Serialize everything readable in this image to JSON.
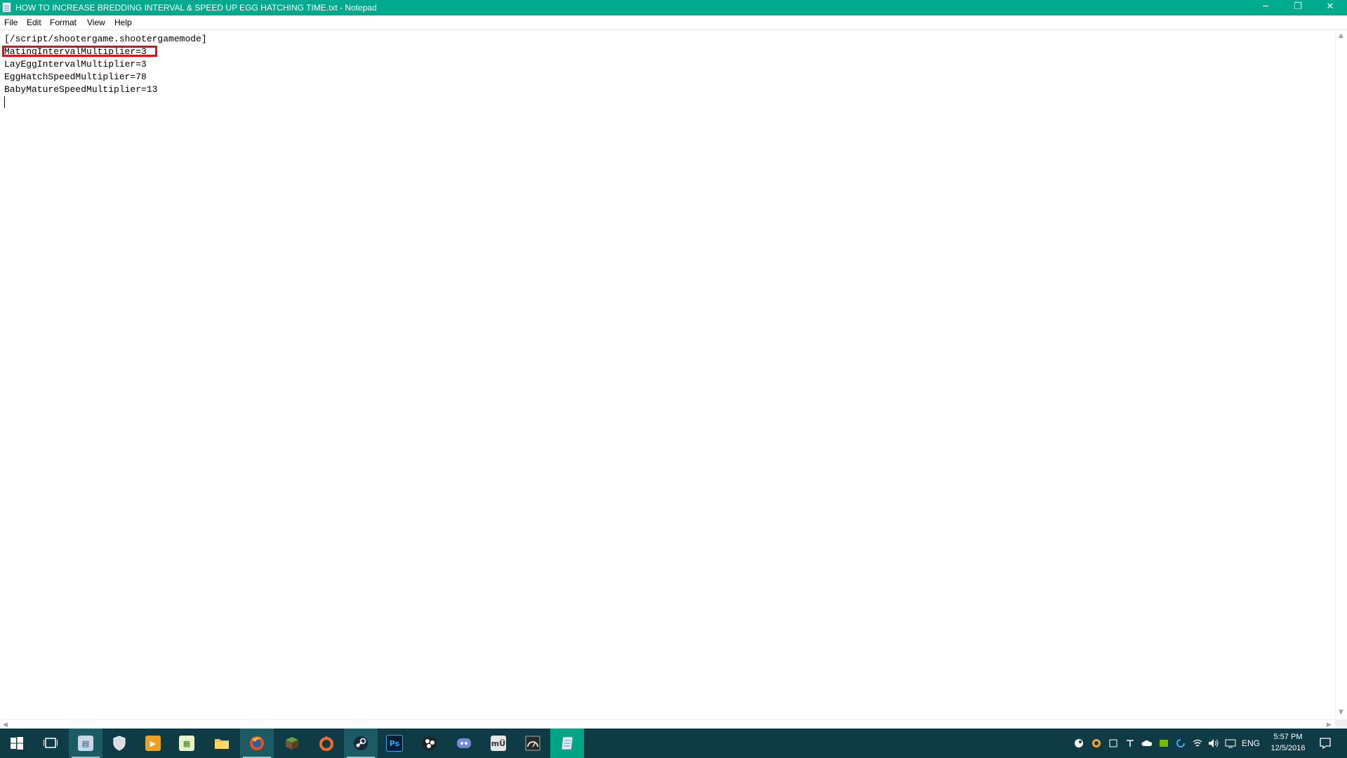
{
  "window": {
    "title": "HOW TO INCREASE BREDDING INTERVAL & SPEED UP EGG HATCHING TIME.txt - Notepad",
    "minimize_glyph": "─",
    "maximize_glyph": "❐",
    "close_glyph": "✕",
    "accent_color": "#00aa8e"
  },
  "menu": {
    "items": [
      "File",
      "Edit",
      "Format",
      "View",
      "Help"
    ]
  },
  "editor": {
    "lines": [
      "[/script/shootergame.shootergamemode]",
      "MatingIntervalMultiplier=3",
      "LayEggIntervalMultiplier=3",
      "EggHatchSpeedMultiplier=78",
      "BabyMatureSpeedMultiplier=13"
    ],
    "highlighted_line": "MatingIntervalMultiplier=3",
    "highlight_color": "#e01010"
  },
  "taskbar": {
    "apps": [
      {
        "name": "start",
        "icon": "windows-logo-icon"
      },
      {
        "name": "task-view",
        "icon": "task-view-icon"
      },
      {
        "name": "app-1",
        "icon": "app-window-icon",
        "active": true
      },
      {
        "name": "app-2",
        "icon": "shield-icon"
      },
      {
        "name": "media",
        "icon": "media-player-icon"
      },
      {
        "name": "spreadsheet",
        "icon": "spreadsheet-icon"
      },
      {
        "name": "file-explorer",
        "icon": "folder-icon"
      },
      {
        "name": "firefox",
        "icon": "firefox-icon",
        "active": true
      },
      {
        "name": "minecraft",
        "icon": "grass-block-icon"
      },
      {
        "name": "origin",
        "icon": "origin-icon"
      },
      {
        "name": "steam",
        "icon": "steam-icon",
        "active": true
      },
      {
        "name": "photoshop",
        "icon": "photoshop-icon",
        "label": "Ps"
      },
      {
        "name": "obs",
        "icon": "obs-icon"
      },
      {
        "name": "discord",
        "icon": "discord-icon"
      },
      {
        "name": "app-mu",
        "icon": "mu-app-icon",
        "label": "mÜ"
      },
      {
        "name": "app-speed",
        "icon": "gauge-icon"
      },
      {
        "name": "notepad",
        "icon": "notepad-icon",
        "current": true
      }
    ],
    "tray": {
      "language": "ENG",
      "time": "5:57 PM",
      "date": "12/5/2016"
    }
  }
}
